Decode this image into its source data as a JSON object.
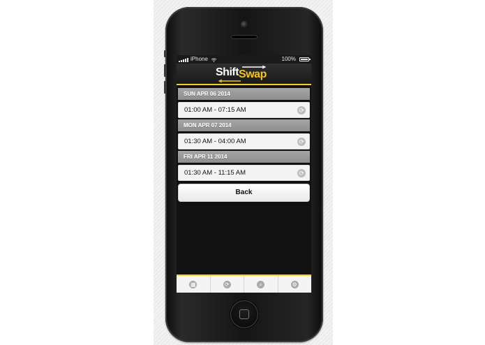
{
  "status_bar": {
    "carrier": "iPhone",
    "battery": "100%"
  },
  "app": {
    "logo_shift": "Shift",
    "logo_swap": "Swap"
  },
  "shifts": [
    {
      "date": "SUN APR 06 2014",
      "time": "01:00 AM - 07:15 AM"
    },
    {
      "date": "MON APR 07 2014",
      "time": "01:30 AM - 04:00 AM"
    },
    {
      "date": "FRI APR 11 2014",
      "time": "01:30 AM - 11:15 AM"
    }
  ],
  "back_label": "Back",
  "icons": {
    "swap": "swap-icon",
    "tab_1": "grid-icon",
    "tab_2": "swap-icon",
    "tab_3": "search-icon",
    "tab_4": "gear-icon"
  },
  "colors": {
    "accent": "#f0cf2a",
    "logo_swap": "#f3c51b",
    "day_header": "#9a9a9a",
    "screen_bg": "#111111"
  }
}
